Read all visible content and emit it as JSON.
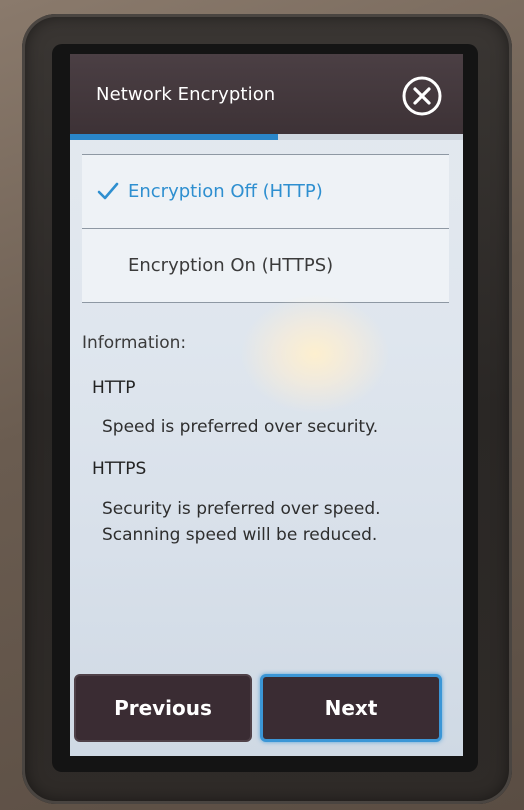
{
  "header": {
    "title": "Network Encryption",
    "close_icon": "close-circle-icon"
  },
  "progress": {
    "value": 0.53,
    "color": "#2a86c9"
  },
  "options": [
    {
      "label": "Encryption Off (HTTP)",
      "selected": true,
      "icon": "checkmark-icon",
      "color": "#2e8fd0"
    },
    {
      "label": "Encryption On (HTTPS)",
      "selected": false
    }
  ],
  "information": {
    "heading": "Information:",
    "items": [
      {
        "title": "HTTP",
        "description": [
          "Speed is preferred over security."
        ]
      },
      {
        "title": "HTTPS",
        "description": [
          "Security is preferred over speed.",
          "Scanning speed will be reduced."
        ]
      }
    ]
  },
  "buttons": {
    "previous_label": "Previous",
    "next_label": "Next"
  },
  "colors": {
    "title_bar": "#3d3236",
    "button_bg": "#3a2c33",
    "accent": "#3b96d6"
  }
}
